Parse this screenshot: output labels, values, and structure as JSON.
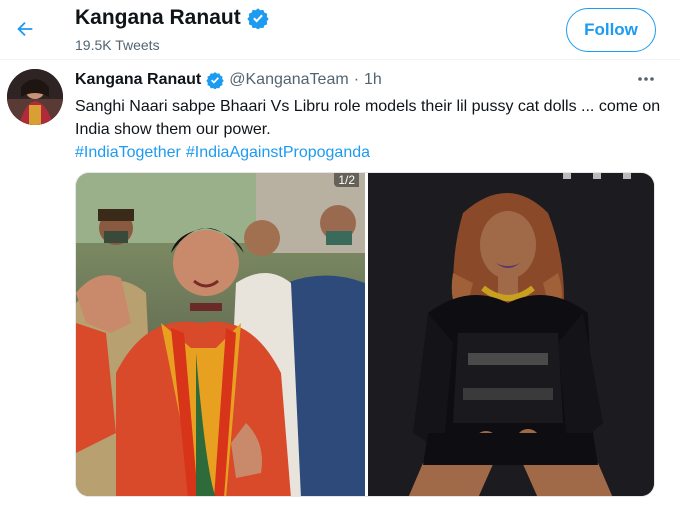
{
  "header": {
    "name": "Kangana Ranaut",
    "tweet_count": "19.5K Tweets",
    "follow_label": "Follow"
  },
  "tweet": {
    "name": "Kangana Ranaut",
    "handle": "@KanganaTeam",
    "separator": "·",
    "time": "1h",
    "text": "Sanghi Naari sabpe Bhaari Vs Libru role models their lil pussy cat dolls ... come on India show them our power.",
    "hashtags": [
      "#IndiaTogether",
      "#IndiaAgainstPropoganda"
    ],
    "media_counter": "1/2"
  },
  "colors": {
    "accent": "#1d9bf0",
    "secondary_text": "#536471",
    "verified": "#1d9bf0"
  },
  "icons": {
    "back": "back-arrow-icon",
    "verified": "verified-badge-icon",
    "more": "more-dots-icon"
  }
}
